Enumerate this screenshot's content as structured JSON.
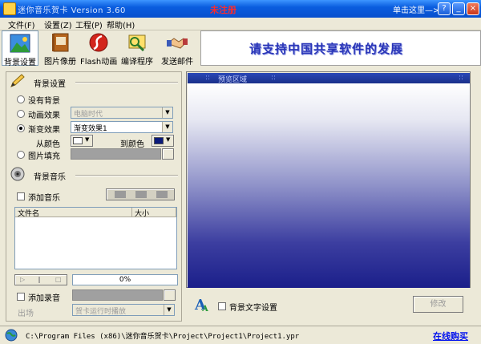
{
  "window": {
    "title": "迷你音乐贺卡 Version 3.60",
    "unregistered": "未注册",
    "click_here": "单击这里—>>",
    "help_btn": "?",
    "min_btn": "_",
    "close_btn": "×"
  },
  "menu": [
    "文件(F)",
    "设置(Z)",
    "工程(P)",
    "帮助(H)"
  ],
  "toolbar": [
    {
      "label": "背景设置",
      "icon": "landscape-icon"
    },
    {
      "label": "图片像册",
      "icon": "photo-album-icon"
    },
    {
      "label": "Flash动画",
      "icon": "flash-icon"
    },
    {
      "label": "编译程序",
      "icon": "compile-icon"
    },
    {
      "label": "发送邮件",
      "icon": "handshake-icon"
    }
  ],
  "banner": {
    "text": "请支持中国共享软件的发展"
  },
  "background": {
    "title": "背景设置",
    "options": [
      "没有背景",
      "动画效果",
      "渐变效果",
      "图片填充"
    ],
    "selected_index": 2,
    "animation_value": "电脑时代",
    "gradient_value": "渐变效果1",
    "from_color_label": "从颜色",
    "to_color_label": "到颜色",
    "from_color": "#ffffff",
    "to_color": "#0a1a7a"
  },
  "music": {
    "title": "背景音乐",
    "add_music": "添加音乐",
    "columns": [
      "文件名",
      "大小"
    ],
    "progress": "0%",
    "add_recording": "添加录音",
    "exit_label": "出场",
    "exit_value": "贺卡运行时播放"
  },
  "preview": {
    "title": "预览区域",
    "bg_text_label": "背景文字设置",
    "modify_btn": "修改"
  },
  "status": {
    "path": "C:\\Program Files (x86)\\迷你音乐贺卡\\Project\\Project1\\Project1.ypr",
    "buy_online": "在线购买"
  }
}
